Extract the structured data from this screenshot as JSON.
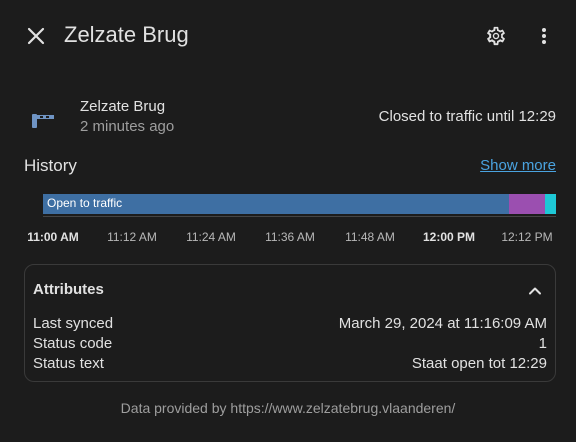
{
  "dialog": {
    "title": "Zelzate Brug"
  },
  "entity": {
    "name": "Zelzate Brug",
    "last_changed": "2 minutes ago",
    "state": "Closed to traffic until 12:29",
    "icon": "boom-gate-icon"
  },
  "history": {
    "title": "History",
    "show_more": "Show more",
    "segments": [
      {
        "label": "Open to traffic",
        "color": "#3e6fa3",
        "fraction": 0.908
      },
      {
        "label": "",
        "color": "#9b4fb0",
        "fraction": 0.07
      },
      {
        "label": "",
        "color": "#1ec8d6",
        "fraction": 0.022
      }
    ],
    "ticks": [
      {
        "label": "11:00 AM",
        "bold": true
      },
      {
        "label": "11:12 AM",
        "bold": false
      },
      {
        "label": "11:24 AM",
        "bold": false
      },
      {
        "label": "11:36 AM",
        "bold": false
      },
      {
        "label": "11:48 AM",
        "bold": false
      },
      {
        "label": "12:00 PM",
        "bold": true
      },
      {
        "label": "12:12 PM",
        "bold": false
      }
    ]
  },
  "attributes": {
    "title": "Attributes",
    "rows": [
      {
        "key": "Last synced",
        "value": "March 29, 2024 at 11:16:09 AM"
      },
      {
        "key": "Status code",
        "value": "1"
      },
      {
        "key": "Status text",
        "value": "Staat open tot 12:29"
      }
    ]
  },
  "footer": "Data provided by https://www.zelzatebrug.vlaanderen/",
  "colors": {
    "background": "#1c1c1c",
    "link": "#4aa3e0",
    "icon": "#6f94c4"
  }
}
